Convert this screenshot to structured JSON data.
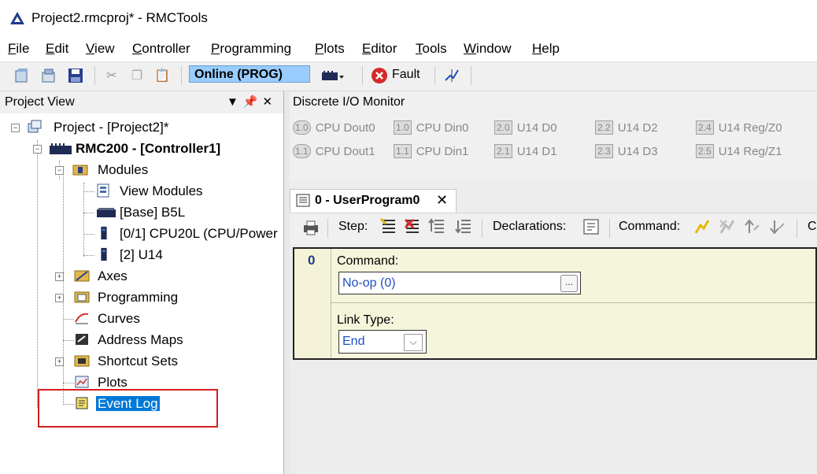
{
  "window": {
    "title": "Project2.rmcproj* - RMCTools"
  },
  "menu": [
    "File",
    "Edit",
    "View",
    "Controller",
    "Programming",
    "Plots",
    "Editor",
    "Tools",
    "Window",
    "Help"
  ],
  "toolbar": {
    "status": "Online (PROG)",
    "fault_label": "Fault"
  },
  "project_view": {
    "title": "Project View",
    "tree": {
      "project": "Project - [Project2]*",
      "controller": "RMC200 - [Controller1]",
      "modules": "Modules",
      "view_modules": "View Modules",
      "base": "[Base] B5L",
      "cpu": "[0/1] CPU20L (CPU/Power",
      "u14": "[2] U14",
      "axes": "Axes",
      "programming": "Programming",
      "curves": "Curves",
      "address_maps": "Address Maps",
      "shortcut_sets": "Shortcut Sets",
      "plots": "Plots",
      "event_log": "Event Log"
    }
  },
  "discrete_io": {
    "title": "Discrete I/O Monitor",
    "items": [
      {
        "badge": "1.0",
        "label": "CPU Dout0"
      },
      {
        "badge": "1.0",
        "label": "CPU Din0"
      },
      {
        "badge": "2.0",
        "label": "U14 D0"
      },
      {
        "badge": "2.2",
        "label": "U14 D2"
      },
      {
        "badge": "2.4",
        "label": "U14 Reg/Z0"
      },
      {
        "badge": "1.1",
        "label": "CPU Dout1"
      },
      {
        "badge": "1.1",
        "label": "CPU Din1"
      },
      {
        "badge": "2.1",
        "label": "U14 D1"
      },
      {
        "badge": "2.3",
        "label": "U14 D3"
      },
      {
        "badge": "2.5",
        "label": "U14 Reg/Z1"
      }
    ]
  },
  "editor": {
    "tab_label": "0 - UserProgram0",
    "toolbar": {
      "step": "Step:",
      "declarations": "Declarations:",
      "command": "Command:",
      "trailing": "C"
    },
    "step": {
      "number": "0",
      "command_label": "Command:",
      "command_value": "No-op (0)",
      "ellipsis": "...",
      "link_type_label": "Link Type:",
      "link_type_value": "End"
    }
  }
}
